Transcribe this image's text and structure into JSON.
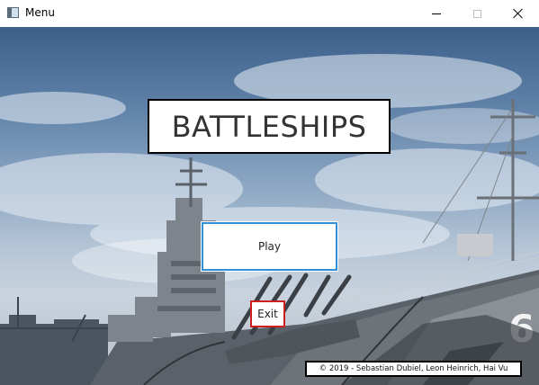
{
  "window": {
    "title": "Menu",
    "icon": "app-window-icon",
    "controls": [
      "minimize-icon",
      "maximize-icon",
      "close-icon"
    ]
  },
  "menu": {
    "title": "BATTLESHIPS",
    "play_label": "Play",
    "exit_label": "Exit",
    "credits": "© 2019 - Sebastian Dubiel, Leon Heinrich, Hai Vu"
  },
  "colors": {
    "play_border": "#2f8fd8",
    "exit_border": "#cc1f1f",
    "title_border": "#000000"
  }
}
